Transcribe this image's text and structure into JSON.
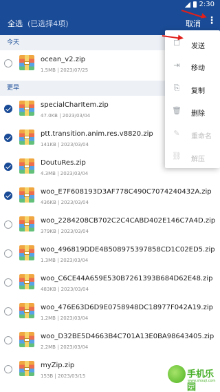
{
  "status_bar": {
    "time": "2:30"
  },
  "top_bar": {
    "select_all": "全选",
    "selected_count": "(已选择4项)",
    "cancel": "取消",
    "more_icon": "⋮"
  },
  "sections": {
    "today": "今天",
    "earlier": "更早"
  },
  "files": [
    {
      "name": "ocean_v2.zip",
      "size": "1.5MB",
      "date": "2023/07/25",
      "checked": false
    },
    {
      "name": "specialCharItem.zip",
      "size": "47.0KB",
      "date": "2023/03/04",
      "checked": true
    },
    {
      "name": "ptt.transition.anim.res.v8820.zip",
      "size": "141KB",
      "date": "2023/03/04",
      "checked": true
    },
    {
      "name": "DoutuRes.zip",
      "size": "4.3MB",
      "date": "2023/03/04",
      "checked": true
    },
    {
      "name": "woo_E7F608193D3AF778C490C7074240432A.zip",
      "size": "436KB",
      "date": "2023/03/04",
      "checked": true
    },
    {
      "name": "woo_2284208CB702C2C4CABD402E146C7A4D.zip",
      "size": "379KB",
      "date": "2023/03/04",
      "checked": false
    },
    {
      "name": "woo_496819DDE4B508975397858CD1C02ED5.zip",
      "size": "1.3MB",
      "date": "2023/03/04",
      "checked": false
    },
    {
      "name": "woo_C6CE44A659E530B7261393B684D62E48.zip",
      "size": "483KB",
      "date": "2023/03/04",
      "checked": false
    },
    {
      "name": "woo_476E63D6D9E0758948DC18977F042A19.zip",
      "size": "1.2MB",
      "date": "2023/03/04",
      "checked": false
    },
    {
      "name": "woo_D32BE5D4663B4C701A13E0BA98643405.zip",
      "size": "2.2MB",
      "date": "2023/03/04",
      "checked": false
    },
    {
      "name": "myZip.zip",
      "size": "153B",
      "date": "2023/03/15",
      "checked": false
    }
  ],
  "menu": [
    {
      "label": "发送",
      "icon": "send-icon",
      "disabled": false
    },
    {
      "label": "移动",
      "icon": "move-icon",
      "disabled": false
    },
    {
      "label": "复制",
      "icon": "copy-icon",
      "disabled": false
    },
    {
      "label": "删除",
      "icon": "delete-icon",
      "disabled": false
    },
    {
      "label": "重命名",
      "icon": "rename-icon",
      "disabled": true
    },
    {
      "label": "解压",
      "icon": "unzip-icon",
      "disabled": true
    }
  ],
  "watermark": {
    "text": "手机乐园",
    "sub": "www.shouji.com"
  },
  "colors": {
    "primary": "#1a4b96",
    "section_bg": "#edf1f6",
    "annotation": "#e0201b"
  }
}
